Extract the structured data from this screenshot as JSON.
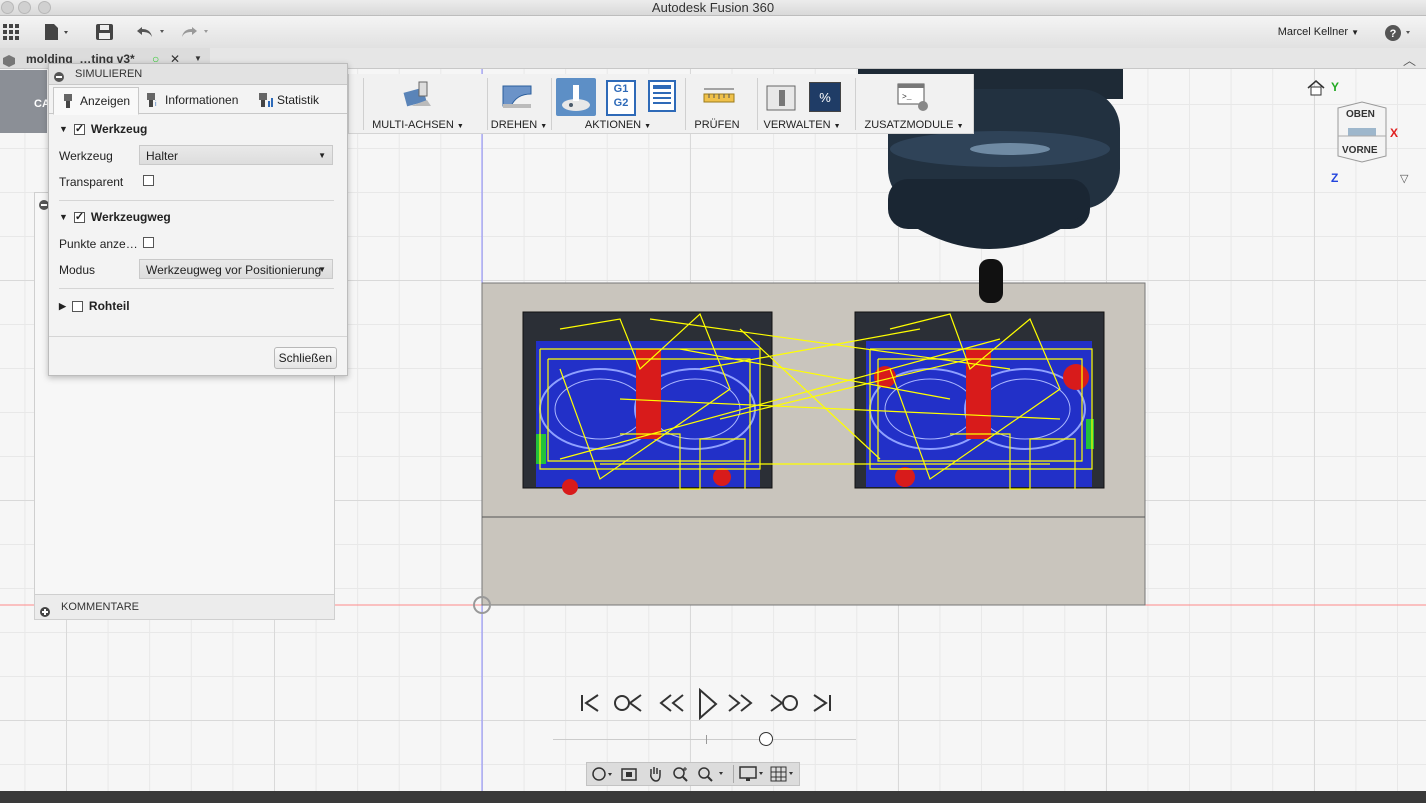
{
  "window": {
    "title": "Autodesk Fusion 360"
  },
  "app_toolbar": {
    "user": "Marcel Kellner",
    "help_icon": "help-icon"
  },
  "document": {
    "tab_title": "molding_…ting v3*"
  },
  "ribbon": {
    "workspace_short": "CA",
    "groups": [
      {
        "label": "MULTI-ACHSEN"
      },
      {
        "label": "DREHEN"
      },
      {
        "label": "AKTIONEN"
      },
      {
        "label": "PRÜFEN"
      },
      {
        "label": "VERWALTEN"
      },
      {
        "label": "ZUSATZMODULE"
      }
    ],
    "g1g2": [
      "G1",
      "G2"
    ],
    "percent": "%"
  },
  "dialog": {
    "title": "SIMULIEREN",
    "tabs": [
      "Anzeigen",
      "Informationen",
      "Statistik"
    ],
    "tool_section": {
      "title": "Werkzeug",
      "checked": true,
      "tool_label": "Werkzeug",
      "tool_value": "Halter",
      "transparent_label": "Transparent",
      "transparent_checked": false
    },
    "toolpath_section": {
      "title": "Werkzeugweg",
      "checked": true,
      "points_label": "Punkte anze…",
      "points_checked": false,
      "mode_label": "Modus",
      "mode_value": "Werkzeugweg vor Positionierung"
    },
    "stock_section": {
      "title": "Rohteil",
      "checked": false
    },
    "close_label": "Schließen"
  },
  "comments": {
    "label": "KOMMENTARE"
  },
  "viewcube": {
    "top": "OBEN",
    "front": "VORNE",
    "axis_x": "X",
    "axis_y": "Y",
    "axis_z": "Z"
  },
  "playback": {
    "progress": 0.16,
    "position": 0.7
  },
  "colors": {
    "toolpath_yellow": "#ffff00",
    "toolpath_blue": "#1a2bd6",
    "collision_red": "#d81b1b",
    "stock_grey": "#c9c5bd",
    "tool_dark": "#1e2a36",
    "axis_x": "#e02020",
    "axis_y": "#22aa22",
    "axis_z": "#2244dd"
  }
}
